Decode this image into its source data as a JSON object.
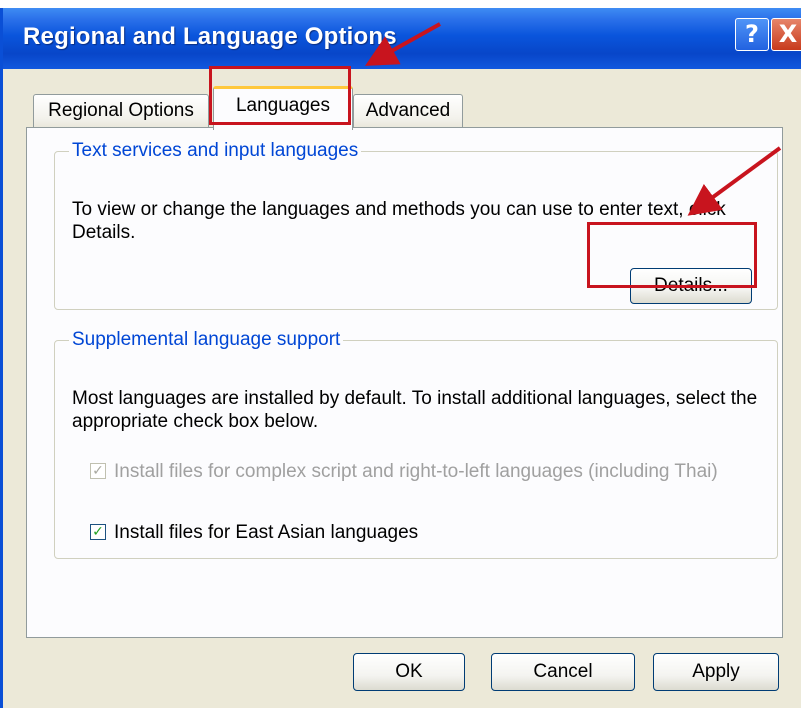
{
  "window": {
    "title": "Regional and Language Options",
    "help_glyph": "?",
    "close_glyph": "X"
  },
  "tabs": [
    {
      "label": "Regional Options",
      "active": false
    },
    {
      "label": "Languages",
      "active": true
    },
    {
      "label": "Advanced",
      "active": false
    }
  ],
  "text_services": {
    "legend": "Text services and input languages",
    "description": "To view or change the languages and methods you can use to enter text, click Details.",
    "details_button": "Details..."
  },
  "supplemental": {
    "legend": "Supplemental language support",
    "description": "Most languages are installed by default. To install additional languages, select the appropriate check box below.",
    "checkboxes": [
      {
        "label": "Install files for complex script and right-to-left languages (including Thai)",
        "checked": true,
        "enabled": false
      },
      {
        "label": "Install files for East Asian languages",
        "checked": true,
        "enabled": true
      }
    ]
  },
  "buttons": {
    "ok": "OK",
    "cancel": "Cancel",
    "apply": "Apply"
  },
  "colors": {
    "titlebar": "#0a55dc",
    "legend": "#0046d5",
    "annotation": "#c8141e",
    "active_tab_accent": "#ffc83c"
  }
}
